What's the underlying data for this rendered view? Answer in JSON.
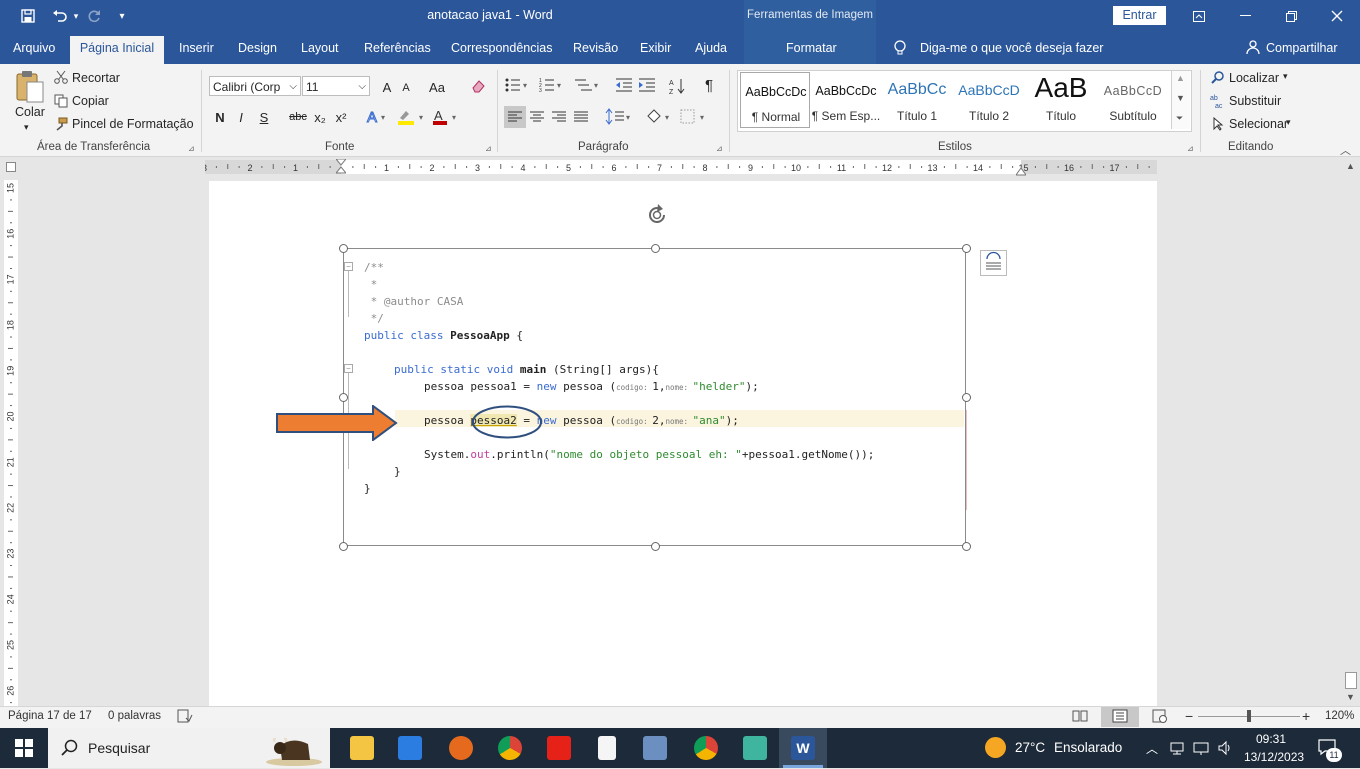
{
  "app": {
    "doc_title": "anotacao java1  -  Word",
    "context_tab_group": "Ferramentas de Imagem",
    "signin_label": "Entrar"
  },
  "quick_access": {
    "save_icon": "save-icon",
    "undo_icon": "undo-icon",
    "redo_icon": "redo-icon",
    "customize_icon": "chevron-down-icon"
  },
  "tabs": [
    "Arquivo",
    "Página Inicial",
    "Inserir",
    "Design",
    "Layout",
    "Referências",
    "Correspondências",
    "Revisão",
    "Exibir",
    "Ajuda",
    "Formatar"
  ],
  "active_tab": "Página Inicial",
  "tell_me": "Diga-me o que você deseja fazer",
  "share_label": "Compartilhar",
  "clipboard": {
    "paste": "Colar",
    "cut": "Recortar",
    "copy": "Copiar",
    "format_painter": "Pincel de Formatação",
    "group": "Área de Transferência"
  },
  "font": {
    "name": "Calibri (Corp",
    "size": "11",
    "group": "Fonte",
    "grow": "A",
    "shrink": "A",
    "case": "Aa",
    "bold": "N",
    "italic": "I",
    "underline": "S",
    "strike": "abc",
    "sub": "x₂",
    "sup": "x²"
  },
  "paragraph": {
    "group": "Parágrafo",
    "pilcrow": "¶"
  },
  "styles": {
    "group": "Estilos",
    "items": [
      {
        "preview": "AaBbCcDc",
        "name": "¶ Normal"
      },
      {
        "preview": "AaBbCcDc",
        "name": "¶ Sem Esp..."
      },
      {
        "preview": "AaBbCc",
        "name": "Título 1"
      },
      {
        "preview": "AaBbCcD",
        "name": "Título 2"
      },
      {
        "preview": "AaB",
        "name": "Título"
      },
      {
        "preview": "AaBbCcD",
        "name": "Subtítulo"
      }
    ]
  },
  "editing": {
    "find": "Localizar",
    "replace": "Substituir",
    "select": "Selecionar",
    "group": "Editando"
  },
  "ruler": {
    "h_labels": [
      "3",
      "2",
      "1",
      "1",
      "2",
      "3",
      "4",
      "5",
      "6",
      "7",
      "8",
      "9",
      "10",
      "11",
      "12",
      "13",
      "14",
      "15",
      "16",
      "17"
    ],
    "v_labels": [
      "15",
      "16",
      "17",
      "18",
      "19",
      "20",
      "21",
      "22",
      "23",
      "24",
      "25",
      "26"
    ]
  },
  "code": {
    "c1": "/**",
    "c2": " *",
    "c3": " * @author CASA",
    "c4": " */",
    "l1_kw": "public class ",
    "l1_name": "PessoaApp",
    "l1_rest": " {",
    "l2_kw": "public static void ",
    "l2_name": "main",
    "l2_rest": " (String[] args){",
    "l3_a": "pessoa pessoa1 = ",
    "l3_new": "new",
    "l3_b": " pessoa ",
    "l3_p1": "(",
    "l3_h1": "codigo: ",
    "l3_v1": "1,",
    "l3_h2": "nome: ",
    "l3_str": "\"helder\"",
    "l3_end": ");",
    "l4_a": "pessoa ",
    "l4_var": "pessoa2",
    "l4_eq": " = ",
    "l4_new": "new",
    "l4_b": " pessoa ",
    "l4_p1": "(",
    "l4_h1": "codigo: ",
    "l4_v1": "2,",
    "l4_h2": "nome: ",
    "l4_str": "\"ana\"",
    "l4_end": ");",
    "l5_a": "System.",
    "l5_out": "out",
    "l5_b": ".println(",
    "l5_str": "\"nome do objeto pessoal eh: \"",
    "l5_c": "+pessoa1.getNome());",
    "l6": "}",
    "l7": "}"
  },
  "status": {
    "page": "Página 17 de 17",
    "words": "0 palavras",
    "zoom": "120%"
  },
  "taskbar": {
    "search": "Pesquisar",
    "weather_temp": "27°C",
    "weather_desc": "Ensolarado",
    "time": "09:31",
    "date": "13/12/2023",
    "notif_count": "11"
  },
  "colors": {
    "word_blue": "#2b579a",
    "arrow_orange": "#ed7d31",
    "circle_navy": "#2f4f7f"
  }
}
